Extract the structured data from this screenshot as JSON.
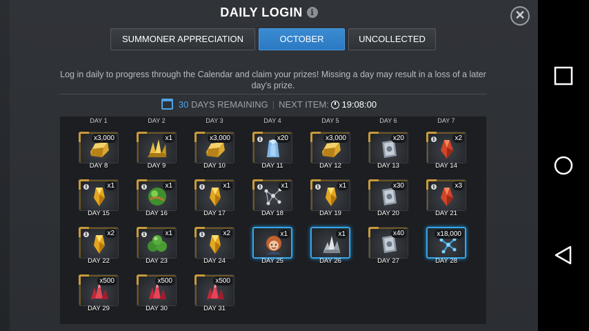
{
  "header": {
    "title": "DAILY LOGIN",
    "info_glyph": "i",
    "close_glyph": "✕"
  },
  "tabs": [
    {
      "label": "SUMMONER APPRECIATION",
      "active": false
    },
    {
      "label": "OCTOBER",
      "active": true
    },
    {
      "label": "UNCOLLECTED",
      "active": false
    }
  ],
  "description": "Log in daily to progress through the Calendar and claim your prizes! Missing a day may result in a loss of a later day's prize.",
  "status": {
    "days_remaining_number": "30",
    "days_remaining_text": "DAYS REMAINING",
    "separator": "|",
    "next_item_label": "NEXT ITEM:",
    "next_item_time": "19:08:00"
  },
  "top_row_labels": [
    "DAY 1",
    "DAY 2",
    "DAY 3",
    "DAY 4",
    "DAY 5",
    "DAY 6",
    "DAY 7"
  ],
  "days": [
    {
      "label": "DAY 8",
      "qty": "x3,000",
      "item": "gold-bar",
      "info": false,
      "highlight": false
    },
    {
      "label": "DAY 9",
      "qty": "x1",
      "item": "gold-shards",
      "info": false,
      "highlight": false
    },
    {
      "label": "DAY 10",
      "qty": "x3,000",
      "item": "gold-bar",
      "info": false,
      "highlight": false
    },
    {
      "label": "DAY 11",
      "qty": "x20",
      "item": "blue-crystal",
      "info": true,
      "highlight": false
    },
    {
      "label": "DAY 12",
      "qty": "x3,000",
      "item": "gold-bar",
      "info": false,
      "highlight": false
    },
    {
      "label": "DAY 13",
      "qty": "x20",
      "item": "silver-card",
      "info": false,
      "highlight": false
    },
    {
      "label": "DAY 14",
      "qty": "x2",
      "item": "red-crystal",
      "info": true,
      "highlight": false
    },
    {
      "label": "DAY 15",
      "qty": "x1",
      "item": "yellow-crystal",
      "info": true,
      "highlight": false
    },
    {
      "label": "DAY 16",
      "qty": "x1",
      "item": "green-orb",
      "info": true,
      "highlight": false
    },
    {
      "label": "DAY 17",
      "qty": "x1",
      "item": "yellow-crystal",
      "info": true,
      "highlight": false
    },
    {
      "label": "DAY 18",
      "qty": "x1",
      "item": "dark-network",
      "info": true,
      "highlight": false
    },
    {
      "label": "DAY 19",
      "qty": "x1",
      "item": "yellow-crystal",
      "info": true,
      "highlight": false
    },
    {
      "label": "DAY 20",
      "qty": "x30",
      "item": "silver-card",
      "info": false,
      "highlight": false
    },
    {
      "label": "DAY 21",
      "qty": "x3",
      "item": "red-crystal",
      "info": true,
      "highlight": false
    },
    {
      "label": "DAY 22",
      "qty": "x2",
      "item": "yellow-crystal",
      "info": true,
      "highlight": false
    },
    {
      "label": "DAY 23",
      "qty": "x1",
      "item": "green-orbs",
      "info": true,
      "highlight": false
    },
    {
      "label": "DAY 24",
      "qty": "x2",
      "item": "yellow-crystal",
      "info": true,
      "highlight": false
    },
    {
      "label": "DAY 25",
      "qty": "x1",
      "item": "champion-portrait",
      "info": false,
      "highlight": true
    },
    {
      "label": "DAY 26",
      "qty": "x1",
      "item": "silver-crystal",
      "info": false,
      "highlight": true
    },
    {
      "label": "DAY 27",
      "qty": "x40",
      "item": "silver-card",
      "info": false,
      "highlight": false
    },
    {
      "label": "DAY 28",
      "qty": "x18,000",
      "item": "blue-network",
      "info": false,
      "highlight": true
    },
    {
      "label": "DAY 29",
      "qty": "x500",
      "item": "red-shards",
      "info": false,
      "highlight": false
    },
    {
      "label": "DAY 30",
      "qty": "x500",
      "item": "red-shards",
      "info": false,
      "highlight": false
    },
    {
      "label": "DAY 31",
      "qty": "x500",
      "item": "red-shards",
      "info": false,
      "highlight": false
    }
  ],
  "colors": {
    "accent_blue": "#2a79c2",
    "highlight_blue": "#36a6e8",
    "gold_border": "#c89a3c"
  }
}
